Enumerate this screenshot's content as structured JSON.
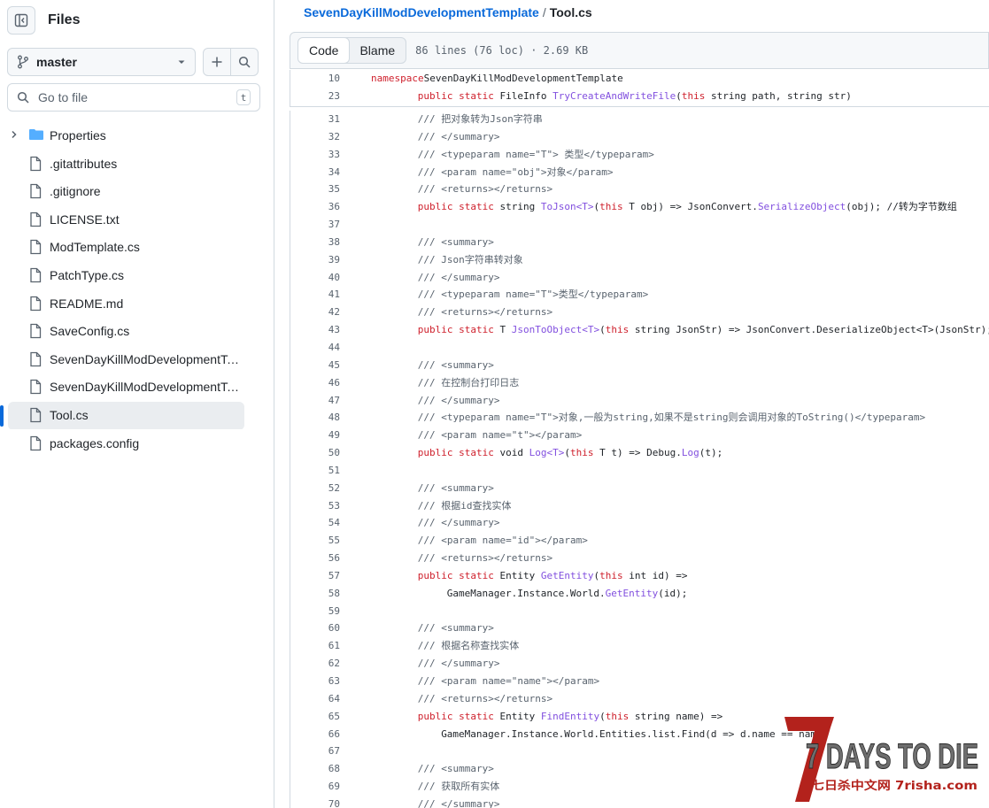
{
  "sidebar": {
    "title": "Files",
    "branch": "master",
    "goto_placeholder": "Go to file",
    "goto_shortcut": "t",
    "items": [
      {
        "label": "Properties",
        "type": "folder"
      },
      {
        "label": ".gitattributes",
        "type": "file"
      },
      {
        "label": ".gitignore",
        "type": "file"
      },
      {
        "label": "LICENSE.txt",
        "type": "file"
      },
      {
        "label": "ModTemplate.cs",
        "type": "file"
      },
      {
        "label": "PatchType.cs",
        "type": "file"
      },
      {
        "label": "README.md",
        "type": "file"
      },
      {
        "label": "SaveConfig.cs",
        "type": "file"
      },
      {
        "label": "SevenDayKillModDevelopmentTe...",
        "type": "file"
      },
      {
        "label": "SevenDayKillModDevelopmentTe...",
        "type": "file"
      },
      {
        "label": "Tool.cs",
        "type": "file",
        "active": true
      },
      {
        "label": "packages.config",
        "type": "file"
      }
    ]
  },
  "breadcrumb": {
    "repo": "SevenDayKillModDevelopmentTemplate",
    "separator": "/",
    "file": "Tool.cs"
  },
  "file_header": {
    "tab_code": "Code",
    "tab_blame": "Blame",
    "meta": "86 lines (76 loc) · 2.69 KB"
  },
  "sticky_lines": [
    {
      "n": "10",
      "indent": 0,
      "parts": [
        [
          "kw",
          "namespace"
        ],
        [
          "",
          "SevenDayKillModDevelopmentTemplate"
        ]
      ]
    },
    {
      "n": "23",
      "indent": 8,
      "parts": [
        [
          "kw",
          "public static"
        ],
        [
          "",
          " FileInfo "
        ],
        [
          "fn",
          "TryCreateAndWriteFile"
        ],
        [
          "",
          "("
        ],
        [
          "kw",
          "this"
        ],
        [
          "",
          " string path, string str)"
        ]
      ]
    }
  ],
  "code_lines": [
    {
      "n": "31",
      "indent": 8,
      "parts": [
        [
          "cm",
          "/// 把对象转为Json字符串"
        ]
      ]
    },
    {
      "n": "32",
      "indent": 8,
      "parts": [
        [
          "cm",
          "/// </summary>"
        ]
      ]
    },
    {
      "n": "33",
      "indent": 8,
      "parts": [
        [
          "cm",
          "/// <typeparam name=\"T\"> 类型</typeparam>"
        ]
      ]
    },
    {
      "n": "34",
      "indent": 8,
      "parts": [
        [
          "cm",
          "/// <param name=\"obj\">对象</param>"
        ]
      ]
    },
    {
      "n": "35",
      "indent": 8,
      "parts": [
        [
          "cm",
          "/// <returns></returns>"
        ]
      ]
    },
    {
      "n": "36",
      "indent": 8,
      "parts": [
        [
          "kw",
          "public static"
        ],
        [
          "",
          " string "
        ],
        [
          "fn",
          "ToJson<T>"
        ],
        [
          "",
          "("
        ],
        [
          "kw",
          "this"
        ],
        [
          "",
          " T obj) => JsonConvert."
        ],
        [
          "fn",
          "SerializeObject"
        ],
        [
          "",
          "(obj); //转为字节数组"
        ]
      ]
    },
    {
      "n": "37",
      "indent": 0,
      "parts": []
    },
    {
      "n": "38",
      "indent": 8,
      "parts": [
        [
          "cm",
          "/// <summary>"
        ]
      ]
    },
    {
      "n": "39",
      "indent": 8,
      "parts": [
        [
          "cm",
          "/// Json字符串转对象"
        ]
      ]
    },
    {
      "n": "40",
      "indent": 8,
      "parts": [
        [
          "cm",
          "/// </summary>"
        ]
      ]
    },
    {
      "n": "41",
      "indent": 8,
      "parts": [
        [
          "cm",
          "/// <typeparam name=\"T\">类型</typeparam>"
        ]
      ]
    },
    {
      "n": "42",
      "indent": 8,
      "parts": [
        [
          "cm",
          "/// <returns></returns>"
        ]
      ]
    },
    {
      "n": "43",
      "indent": 8,
      "parts": [
        [
          "kw",
          "public static"
        ],
        [
          "",
          " T "
        ],
        [
          "fn",
          "JsonToObject<T>"
        ],
        [
          "",
          "("
        ],
        [
          "kw",
          "this"
        ],
        [
          "",
          " string JsonStr) => JsonConvert.DeserializeObject<T>(JsonStr);"
        ]
      ]
    },
    {
      "n": "44",
      "indent": 0,
      "parts": []
    },
    {
      "n": "45",
      "indent": 8,
      "parts": [
        [
          "cm",
          "/// <summary>"
        ]
      ]
    },
    {
      "n": "46",
      "indent": 8,
      "parts": [
        [
          "cm",
          "/// 在控制台打印日志"
        ]
      ]
    },
    {
      "n": "47",
      "indent": 8,
      "parts": [
        [
          "cm",
          "/// </summary>"
        ]
      ]
    },
    {
      "n": "48",
      "indent": 8,
      "parts": [
        [
          "cm",
          "/// <typeparam name=\"T\">对象,一般为string,如果不是string则会调用对象的ToString()</typeparam>"
        ]
      ]
    },
    {
      "n": "49",
      "indent": 8,
      "parts": [
        [
          "cm",
          "/// <param name=\"t\"></param>"
        ]
      ]
    },
    {
      "n": "50",
      "indent": 8,
      "parts": [
        [
          "kw",
          "public static"
        ],
        [
          "",
          " void "
        ],
        [
          "fn",
          "Log<T>"
        ],
        [
          "",
          "("
        ],
        [
          "kw",
          "this"
        ],
        [
          "",
          " T t) => Debug."
        ],
        [
          "fn",
          "Log"
        ],
        [
          "",
          "(t);"
        ]
      ]
    },
    {
      "n": "51",
      "indent": 0,
      "parts": []
    },
    {
      "n": "52",
      "indent": 8,
      "parts": [
        [
          "cm",
          "/// <summary>"
        ]
      ]
    },
    {
      "n": "53",
      "indent": 8,
      "parts": [
        [
          "cm",
          "/// 根据id查找实体"
        ]
      ]
    },
    {
      "n": "54",
      "indent": 8,
      "parts": [
        [
          "cm",
          "/// </summary>"
        ]
      ]
    },
    {
      "n": "55",
      "indent": 8,
      "parts": [
        [
          "cm",
          "/// <param name=\"id\"></param>"
        ]
      ]
    },
    {
      "n": "56",
      "indent": 8,
      "parts": [
        [
          "cm",
          "/// <returns></returns>"
        ]
      ]
    },
    {
      "n": "57",
      "indent": 8,
      "parts": [
        [
          "kw",
          "public static"
        ],
        [
          "",
          " Entity "
        ],
        [
          "fn",
          "GetEntity"
        ],
        [
          "",
          "("
        ],
        [
          "kw",
          "this"
        ],
        [
          "",
          " int id) =>"
        ]
      ]
    },
    {
      "n": "58",
      "indent": 13,
      "parts": [
        [
          "",
          "GameManager.Instance.World."
        ],
        [
          "fn",
          "GetEntity"
        ],
        [
          "",
          "(id);"
        ]
      ]
    },
    {
      "n": "59",
      "indent": 0,
      "parts": []
    },
    {
      "n": "60",
      "indent": 8,
      "parts": [
        [
          "cm",
          "/// <summary>"
        ]
      ]
    },
    {
      "n": "61",
      "indent": 8,
      "parts": [
        [
          "cm",
          "/// 根据名称查找实体"
        ]
      ]
    },
    {
      "n": "62",
      "indent": 8,
      "parts": [
        [
          "cm",
          "/// </summary>"
        ]
      ]
    },
    {
      "n": "63",
      "indent": 8,
      "parts": [
        [
          "cm",
          "/// <param name=\"name\"></param>"
        ]
      ]
    },
    {
      "n": "64",
      "indent": 8,
      "parts": [
        [
          "cm",
          "/// <returns></returns>"
        ]
      ]
    },
    {
      "n": "65",
      "indent": 8,
      "parts": [
        [
          "kw",
          "public static"
        ],
        [
          "",
          " Entity "
        ],
        [
          "fn",
          "FindEntity"
        ],
        [
          "",
          "("
        ],
        [
          "kw",
          "this"
        ],
        [
          "",
          " string name) =>"
        ]
      ]
    },
    {
      "n": "66",
      "indent": 12,
      "parts": [
        [
          "",
          "GameManager.Instance.World.Entities.list.Find(d => d.name == name"
        ]
      ]
    },
    {
      "n": "67",
      "indent": 0,
      "parts": []
    },
    {
      "n": "68",
      "indent": 8,
      "parts": [
        [
          "cm",
          "/// <summary>"
        ]
      ]
    },
    {
      "n": "69",
      "indent": 8,
      "parts": [
        [
          "cm",
          "/// 获取所有实体"
        ]
      ]
    },
    {
      "n": "70",
      "indent": 8,
      "parts": [
        [
          "cm",
          "/// </summary>"
        ]
      ]
    }
  ],
  "watermark": {
    "text": "7 DAYS TO DIE",
    "subtext": "七日杀中文网 7risha.com",
    "colors": {
      "red": "#b3221c",
      "grey": "#6e6e6e"
    }
  },
  "colors": {
    "link": "#0969da",
    "keyword": "#cf222e",
    "function": "#8250df",
    "comment": "#59636e",
    "active_bar": "#0969da"
  }
}
